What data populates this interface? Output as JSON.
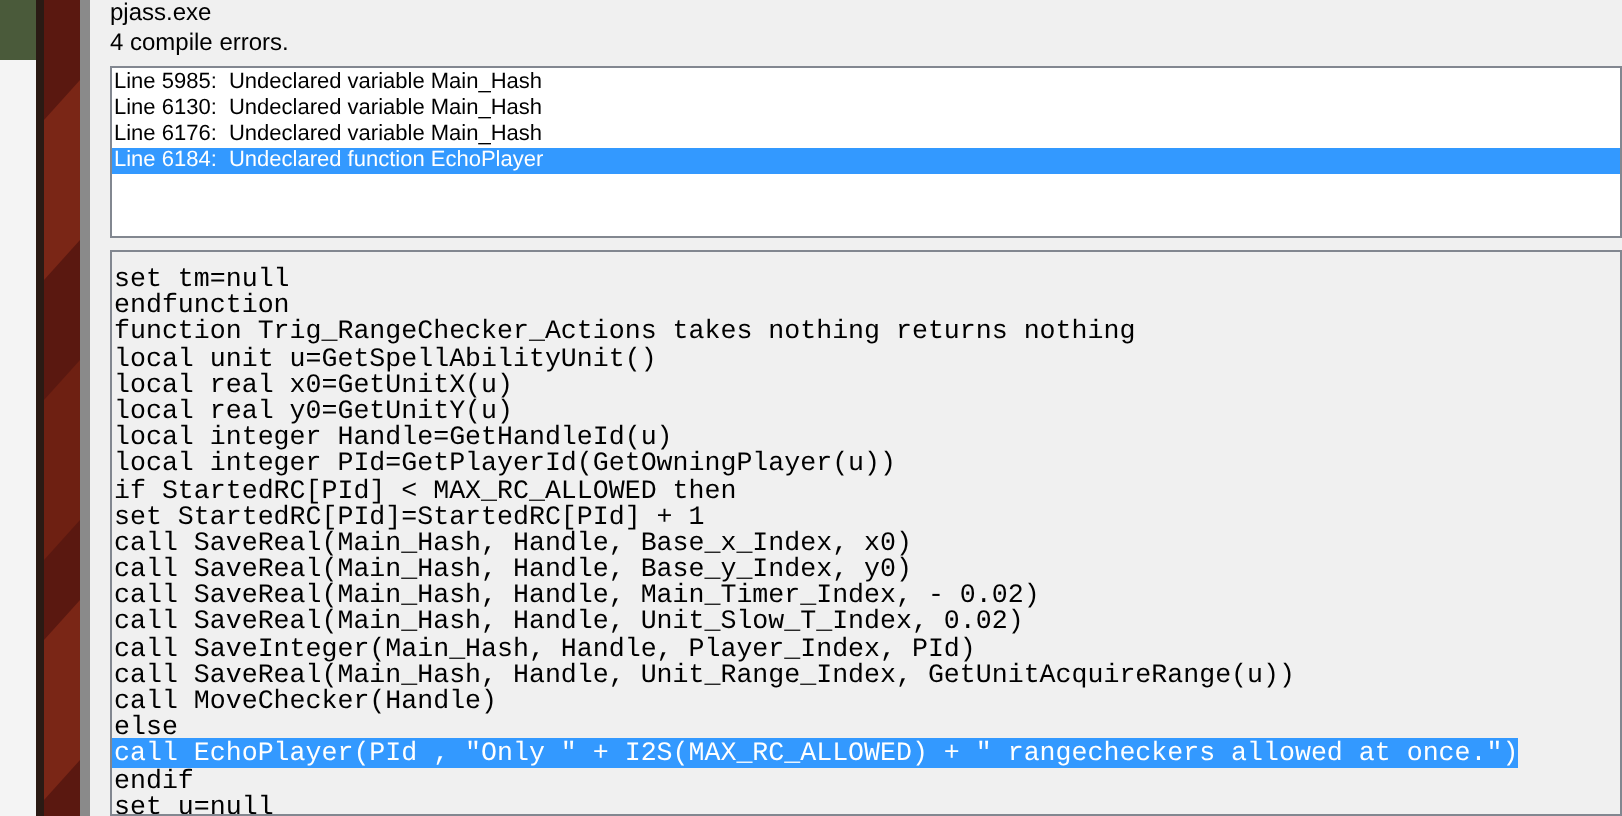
{
  "window": {
    "title": "pjass.exe"
  },
  "summary": "4 compile errors.",
  "errors": [
    {
      "text": "Line 5985:  Undeclared variable Main_Hash",
      "selected": false
    },
    {
      "text": "Line 6130:  Undeclared variable Main_Hash",
      "selected": false
    },
    {
      "text": "Line 6176:  Undeclared variable Main_Hash",
      "selected": false
    },
    {
      "text": "Line 6184:  Undeclared function EchoPlayer",
      "selected": true
    }
  ],
  "code_lines": [
    {
      "text": "set tm=null",
      "selected": false
    },
    {
      "text": "endfunction",
      "selected": false
    },
    {
      "text": "function Trig_RangeChecker_Actions takes nothing returns nothing",
      "selected": false
    },
    {
      "text": "local unit u=GetSpellAbilityUnit()",
      "selected": false
    },
    {
      "text": "local real x0=GetUnitX(u)",
      "selected": false
    },
    {
      "text": "local real y0=GetUnitY(u)",
      "selected": false
    },
    {
      "text": "local integer Handle=GetHandleId(u)",
      "selected": false
    },
    {
      "text": "local integer PId=GetPlayerId(GetOwningPlayer(u))",
      "selected": false
    },
    {
      "text": "if StartedRC[PId] < MAX_RC_ALLOWED then",
      "selected": false
    },
    {
      "text": "set StartedRC[PId]=StartedRC[PId] + 1",
      "selected": false
    },
    {
      "text": "call SaveReal(Main_Hash, Handle, Base_x_Index, x0)",
      "selected": false
    },
    {
      "text": "call SaveReal(Main_Hash, Handle, Base_y_Index, y0)",
      "selected": false
    },
    {
      "text": "call SaveReal(Main_Hash, Handle, Main_Timer_Index, - 0.02)",
      "selected": false
    },
    {
      "text": "call SaveReal(Main_Hash, Handle, Unit_Slow_T_Index, 0.02)",
      "selected": false
    },
    {
      "text": "call SaveInteger(Main_Hash, Handle, Player_Index, PId)",
      "selected": false
    },
    {
      "text": "call SaveReal(Main_Hash, Handle, Unit_Range_Index, GetUnitAcquireRange(u))",
      "selected": false
    },
    {
      "text": "call MoveChecker(Handle)",
      "selected": false
    },
    {
      "text": "else",
      "selected": false
    },
    {
      "text": "call EchoPlayer(PId , \"Only \" + I2S(MAX_RC_ALLOWED) + \" rangecheckers allowed at once.\")",
      "selected": true
    },
    {
      "text": "endif",
      "selected": false
    },
    {
      "text": "set u=null",
      "selected": false
    }
  ]
}
